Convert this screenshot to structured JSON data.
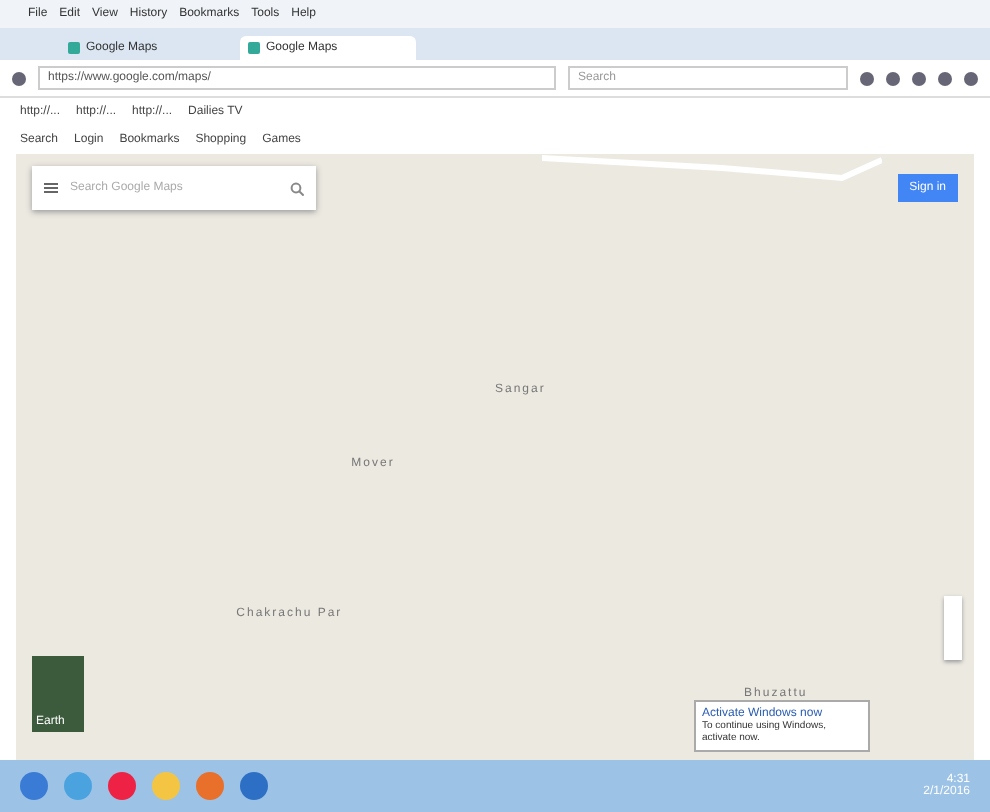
{
  "menu": [
    "File",
    "Edit",
    "View",
    "History",
    "Bookmarks",
    "Tools",
    "Help"
  ],
  "tabs": [
    {
      "label": "Google Maps",
      "selected": false
    },
    {
      "label": "Google Maps",
      "selected": true
    }
  ],
  "address": {
    "value": "https://www.google.com/maps/"
  },
  "search": {
    "placeholder": "Search"
  },
  "bookmarks": [
    "http://...",
    "http://...",
    "http://...",
    "Dailies TV"
  ],
  "toolbar": [
    {
      "label": "Search"
    },
    {
      "label": "Login"
    },
    {
      "label": "Bookmarks"
    },
    {
      "label": "Shopping"
    },
    {
      "label": "Games"
    }
  ],
  "maps_search": {
    "placeholder": "Search Google Maps"
  },
  "sign_in": "Sign in",
  "places": [
    {
      "name": "Sangar"
    },
    {
      "name": "Mover"
    },
    {
      "name": "Chakrachu Par"
    },
    {
      "name": "Bhuzattu"
    }
  ],
  "satellite_label": "Earth",
  "notification": {
    "title": "Activate Windows now",
    "body": "To continue using Windows, activate now."
  },
  "clock": {
    "time": "4:31",
    "date": "2/1/2016"
  }
}
